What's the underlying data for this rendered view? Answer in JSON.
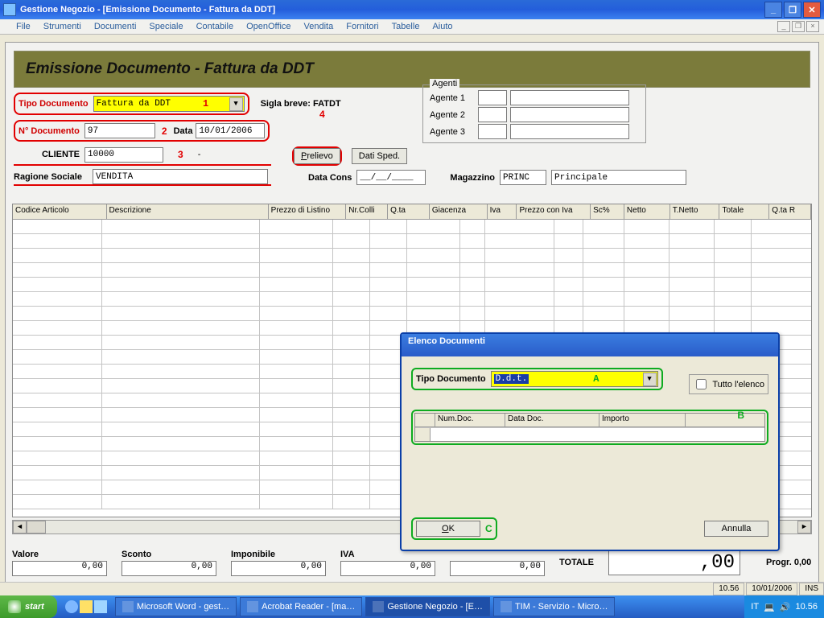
{
  "window": {
    "title": "Gestione Negozio - [Emissione Documento - Fattura da DDT]"
  },
  "menu": [
    "File",
    "Strumenti",
    "Documenti",
    "Speciale",
    "Contabile",
    "OpenOffice",
    "Vendita",
    "Fornitori",
    "Tabelle",
    "Aiuto"
  ],
  "banner": {
    "title": "Emissione Documento - Fattura da DDT"
  },
  "form": {
    "tipo_doc_label": "Tipo Documento",
    "tipo_doc_value": "Fattura da DDT",
    "sigla_label": "Sigla breve: FATDT",
    "num_doc_label": "N° Documento",
    "num_doc_value": "97",
    "data_label": "Data",
    "data_value": "10/01/2006",
    "cliente_label": "CLIENTE",
    "cliente_value": "10000",
    "cliente_sep": "-",
    "ragione_label": "Ragione Sociale",
    "ragione_value": "VENDITA",
    "prelievo_btn": "Prelievo",
    "dati_sped_btn": "Dati Sped.",
    "data_cons_label": "Data Cons",
    "data_cons_value": "__/__/____",
    "magazzino_label": "Magazzino",
    "magazzino_code": "PRINC",
    "magazzino_desc": "Principale",
    "agenti_legend": "Agenti",
    "agente1": "Agente 1",
    "agente2": "Agente 2",
    "agente3": "Agente 3"
  },
  "annotations": {
    "a1": "1",
    "a2": "2",
    "a3": "3",
    "a4": "4",
    "aA": "A",
    "aB": "B",
    "aC": "C"
  },
  "grid_headers": [
    "Codice Articolo",
    "Descrizione",
    "Prezzo di Listino",
    "Nr.Colli",
    "Q.ta",
    "Giacenza",
    "Iva",
    "Prezzo con Iva",
    "Sc%",
    "Netto",
    "T.Netto",
    "Totale",
    "Q.ta R"
  ],
  "grid_widths": [
    110,
    195,
    90,
    45,
    45,
    65,
    30,
    85,
    35,
    50,
    55,
    55,
    45
  ],
  "totals": {
    "valore_l": "Valore",
    "valore_v": "0,00",
    "sconto_l": "Sconto",
    "sconto_v": "0,00",
    "imponibile_l": "Imponibile",
    "imponibile_v": "0,00",
    "iva_l": "IVA",
    "iva_v": "0,00",
    "iva2_v": "0,00",
    "totale_l": "TOTALE",
    "totale_v": ",00",
    "progr_l": "Progr. 0,00"
  },
  "dialog": {
    "title": "Elenco Documenti",
    "tipo_label": "Tipo Documento",
    "tipo_value": "D.d.t.",
    "tutto_label": "Tutto l'elenco",
    "cols": [
      "Num.Doc.",
      "Data Doc.",
      "Importo"
    ],
    "ok": "OK",
    "annulla": "Annulla"
  },
  "status": {
    "time": "10.56",
    "date": "10/01/2006",
    "ins": "INS"
  },
  "taskbar": {
    "start": "start",
    "items": [
      "Microsoft Word - gest…",
      "Acrobat Reader - [ma…",
      "Gestione Negozio - [E…",
      "TIM - Servizio - Micro…"
    ],
    "active_index": 2,
    "lang": "IT",
    "clock": "10.56"
  }
}
